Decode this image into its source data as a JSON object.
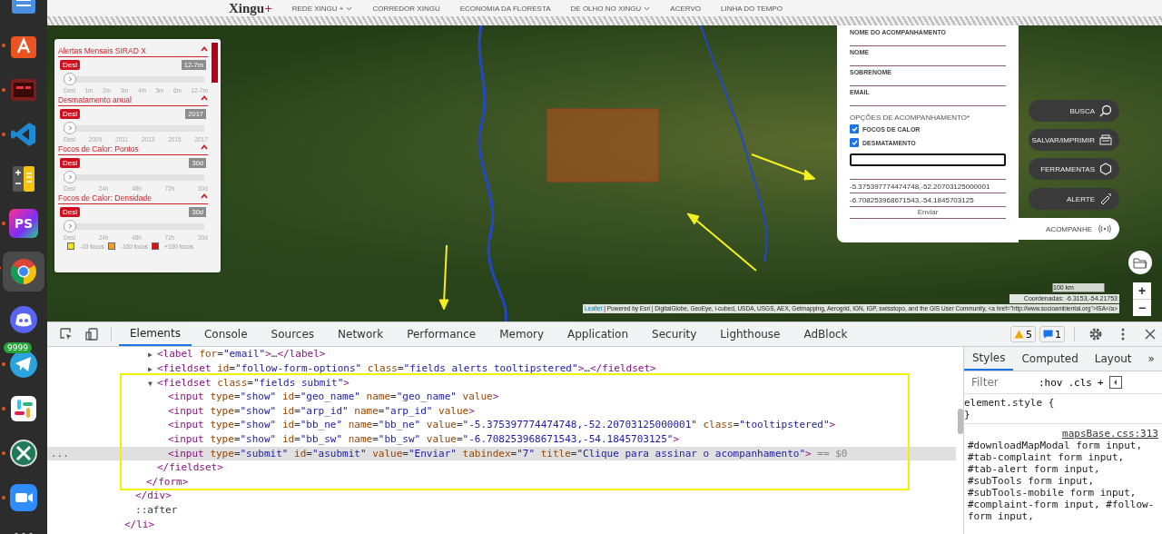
{
  "dock": {
    "items": [
      {
        "kind": "notes",
        "running": false
      },
      {
        "kind": "store",
        "running": true
      },
      {
        "kind": "terminal",
        "running": true
      },
      {
        "kind": "code",
        "running": true
      },
      {
        "kind": "calculator",
        "running": false
      },
      {
        "kind": "ps",
        "label": "PS",
        "running": true
      },
      {
        "kind": "chrome",
        "running": true,
        "selected": true
      },
      {
        "kind": "discord",
        "running": false
      },
      {
        "kind": "telegram",
        "running": true,
        "badge": "9999"
      },
      {
        "kind": "slack",
        "running": true
      },
      {
        "kind": "xapp",
        "running": true
      },
      {
        "kind": "zoom",
        "running": true
      },
      {
        "kind": "apps",
        "running": false
      }
    ]
  },
  "site": {
    "logo": {
      "text": "Xingu",
      "accent": "+"
    },
    "nav": [
      {
        "label": "REDE XINGU +",
        "dropdown": true
      },
      {
        "label": "CORREDOR XINGU",
        "dropdown": false
      },
      {
        "label": "ECONOMIA DA FLORESTA",
        "dropdown": false
      },
      {
        "label": "DE OLHO NO XINGU",
        "dropdown": true
      },
      {
        "label": "ACERVO",
        "dropdown": false
      },
      {
        "label": "LINHA DO TEMPO",
        "dropdown": false
      }
    ]
  },
  "layers_panel": {
    "sections": [
      {
        "title": "Alertas Mensais SIRAD X",
        "off_button": "Desl",
        "value": "12-7m",
        "level": 0,
        "ticks": [
          "Desl",
          "1m",
          "2m",
          "3m",
          "4m",
          "5m",
          "6m",
          "12-7m"
        ]
      },
      {
        "title": "Desmatamento anual",
        "off_button": "Desl",
        "value": "2017",
        "level": 0,
        "ticks": [
          "Desl",
          "2009",
          "2011",
          "2013",
          "2015",
          "2017"
        ]
      },
      {
        "title": "Focos de Calor: Pontos",
        "off_button": "Desl",
        "value": "30d",
        "level": 0,
        "ticks": [
          "Desl",
          "24h",
          "48h",
          "72h",
          "30d"
        ]
      },
      {
        "title": "Focos de Calor: Densidade",
        "off_button": "Desl",
        "value": "30d",
        "level": 0,
        "ticks": [
          "Desl",
          "24h",
          "48h",
          "72h",
          "30d"
        ]
      }
    ],
    "legend": [
      {
        "label": "-10 focos",
        "color": "#f2e21a"
      },
      {
        "label": "-100 focos",
        "color": "#f0a020"
      },
      {
        "label": "+100 focos",
        "color": "#e01010"
      }
    ]
  },
  "follow_form": {
    "fields": [
      {
        "label": "NOME DO ACOMPANHAMENTO"
      },
      {
        "label": "NOME"
      },
      {
        "label": "SOBRENOME"
      },
      {
        "label": "EMAIL"
      }
    ],
    "options_label": "OPÇÕES DE ACOMPANHAMENTO*",
    "options": [
      {
        "label": "FOCOS DE CALOR",
        "checked": true
      },
      {
        "label": "DESMATAMENTO",
        "checked": true
      }
    ],
    "inputs": [
      {
        "focused": true
      },
      {
        "focused": false
      },
      {
        "value": "-5.375397774474748,-52.20703125000001",
        "focused": false
      },
      {
        "value": "-6.708253968671543,-54.1845703125",
        "focused": false
      }
    ],
    "submit": "Enviar"
  },
  "map_buttons": [
    {
      "label": "BUSCA",
      "kind": "search"
    },
    {
      "label": "SALVAR/IMPRIMIR",
      "kind": "printer"
    },
    {
      "label": "FERRAMENTAS",
      "kind": "hexagon"
    },
    {
      "label": "ALERTE",
      "kind": "spray"
    }
  ],
  "follow_button": {
    "label": "ACOMPANHE"
  },
  "map": {
    "scale": "100 km",
    "coordinates": "Coordenadas: -6.3153,-54.21753",
    "zoom_in": "+",
    "zoom_out": "−",
    "attribution_link": "Leaflet",
    "attribution": " | Powered by Esri | DigitalGlobe, GeoEye, i-cubed, USDA, USGS, AEX, Getmapping, Aerogrid, IGN, IGP, swisstopo, and the GIS User Community, <a href=\"http://www.socioambiental.org\">ISA</a>"
  },
  "devtools": {
    "tabs": [
      {
        "label": "Elements",
        "selected": true
      },
      {
        "label": "Console",
        "selected": false
      },
      {
        "label": "Sources",
        "selected": false
      },
      {
        "label": "Network",
        "selected": false
      },
      {
        "label": "Performance",
        "selected": false
      },
      {
        "label": "Memory",
        "selected": false
      },
      {
        "label": "Application",
        "selected": false
      },
      {
        "label": "Security",
        "selected": false
      },
      {
        "label": "Lighthouse",
        "selected": false
      },
      {
        "label": "AdBlock",
        "selected": false
      }
    ],
    "warnings": "5",
    "messages": "1",
    "tree": [
      {
        "close": "</li>",
        "children": [
          {
            "close": "</div>",
            "children": [
              {
                "close": "</form>",
                "children": [
                  {
                    "text": "<label for=\"email\">…</label>",
                    "toggle": "▶",
                    "selected": false
                  },
                  {
                    "text": "<fieldset id=\"follow-form-options\" class=\"fields alerts tooltipstered\">…</fieldset>",
                    "toggle": "▶",
                    "selected": false
                  },
                  {
                    "text": "<fieldset class=\"fields submit\">",
                    "toggle": "▼",
                    "selected": false,
                    "close": "</fieldset>",
                    "children": [
                      {
                        "text": "<input type=\"show\" id=\"geo_name\" name=\"geo_name\" value>",
                        "selected": false
                      },
                      {
                        "text": "<input type=\"show\" id=\"arp_id\" name=\"arp_id\" value>",
                        "selected": false
                      },
                      {
                        "text": "<input type=\"show\" id=\"bb_ne\" name=\"bb_ne\" value=\"-5.375397774474748,-52.20703125000001\" class=\"tooltipstered\">",
                        "selected": false
                      },
                      {
                        "text": "<input type=\"show\" id=\"bb_sw\" name=\"bb_sw\" value=\"-6.708253968671543,-54.1845703125\">",
                        "selected": false
                      },
                      {
                        "text": "<input type=\"submit\" id=\"asubmit\" value=\"Enviar\" tabindex=\"7\" title=\"Clique para assinar o acompanhamento\">",
                        "selected": true,
                        "marker": "...",
                        "suffix": "== $0"
                      }
                    ]
                  }
                ]
              }
            ]
          },
          {
            "text": "::after",
            "selected": false
          }
        ]
      }
    ],
    "styles": {
      "tabs": [
        {
          "label": "Styles",
          "selected": true
        },
        {
          "label": "Computed",
          "selected": false
        },
        {
          "label": "Layout",
          "selected": false
        }
      ],
      "more": "»",
      "filter_placeholder": "Filter",
      "hov": ":hov",
      "cls": ".cls",
      "add": "+",
      "element_style_open": "element.style {",
      "element_style_close": "}",
      "rule_source": "mapsBase.css:313",
      "rule_selector": "#downloadMapModal form input, #tab-complaint form input, #tab-alert form input, #subTools form input, #subTools-mobile form input, #complaint-form input, #follow-form input,"
    }
  }
}
